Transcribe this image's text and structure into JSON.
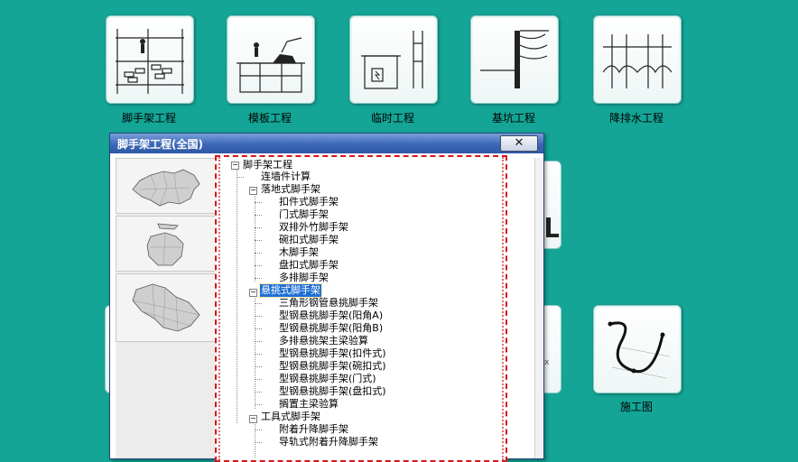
{
  "tiles": [
    {
      "label": "脚手架工程",
      "icon": "scaffold-icon"
    },
    {
      "label": "模板工程",
      "icon": "formwork-icon"
    },
    {
      "label": "临时工程",
      "icon": "temporary-works-icon"
    },
    {
      "label": "基坑工程",
      "icon": "foundation-pit-icon"
    },
    {
      "label": "降排水工程",
      "icon": "dewatering-icon"
    },
    {
      "label": "施工图",
      "icon": "construction-drawing-icon"
    }
  ],
  "dialog": {
    "title": "脚手架工程(全国)",
    "close_label": "✕",
    "maps": [
      "china-map",
      "shanghai-map",
      "jiangsu-map"
    ]
  },
  "tree": {
    "root": "脚手架工程",
    "items": [
      "连墙件计算",
      "落地式脚手架",
      "扣件式脚手架",
      "门式脚手架",
      "双排外竹脚手架",
      "碗扣式脚手架",
      "木脚手架",
      "盘扣式脚手架",
      "多排脚手架",
      "悬挑式脚手架",
      "三角形钢管悬挑脚手架",
      "型钢悬挑脚手架(阳角A)",
      "型钢悬挑脚手架(阳角B)",
      "多排悬挑架主梁验算",
      "型钢悬挑脚手架(扣件式)",
      "型钢悬挑脚手架(碗扣式)",
      "型钢悬挑脚手架(门式)",
      "型钢悬挑脚手架(盘扣式)",
      "搁置主梁验算",
      "工具式脚手架",
      "附着升降脚手架",
      "导轨式附着升降脚手架"
    ],
    "selected": "悬挑式脚手架"
  },
  "colors": {
    "background": "#14a596",
    "titlebar": "#3c67b7",
    "selection": "#1f6fd6",
    "dash": "#d6151c"
  }
}
